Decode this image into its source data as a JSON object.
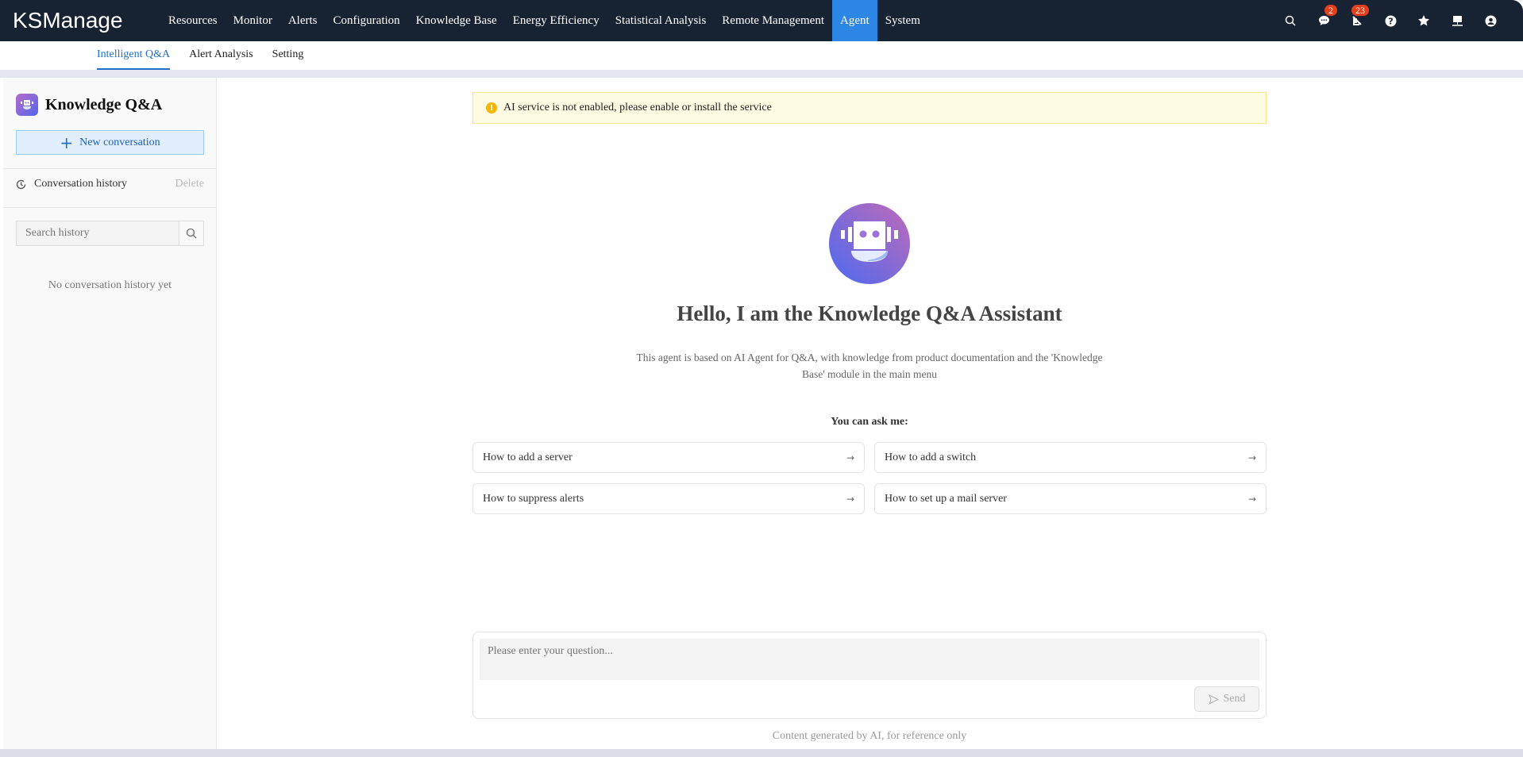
{
  "app": {
    "logo": "KSManage"
  },
  "nav": {
    "items": [
      "Resources",
      "Monitor",
      "Alerts",
      "Configuration",
      "Knowledge Base",
      "Energy Efficiency",
      "Statistical Analysis",
      "Remote Management",
      "Agent",
      "System"
    ],
    "active": "Agent"
  },
  "header_icons": {
    "messages_badge": "2",
    "alerts_badge": "23"
  },
  "subnav": {
    "items": [
      "Intelligent Q&A",
      "Alert Analysis",
      "Setting"
    ],
    "active": "Intelligent Q&A"
  },
  "sidebar": {
    "title": "Knowledge Q&A",
    "new_conversation": "New conversation",
    "history_label": "Conversation history",
    "delete_label": "Delete",
    "search_placeholder": "Search history",
    "empty_text": "No conversation history yet"
  },
  "main": {
    "alert": "AI service is not enabled, please enable or install the service",
    "heading": "Hello, I am the Knowledge Q&A Assistant",
    "description": "This agent is based on AI Agent for Q&A, with knowledge from product documentation and the 'Knowledge Base' module in the main menu",
    "ask_label": "You can ask me:",
    "suggestions": [
      "How to add a server",
      "How to add a switch",
      "How to suppress alerts",
      "How to set up a mail server"
    ],
    "input_placeholder": "Please enter your question...",
    "send_label": "Send",
    "footer": "Content generated by AI, for reference only"
  },
  "colors": {
    "topbar": "#172233",
    "active_nav": "#2b87e3",
    "accent": "#1f6fc8",
    "badge": "#e0401c",
    "warning": "#f5b400"
  }
}
